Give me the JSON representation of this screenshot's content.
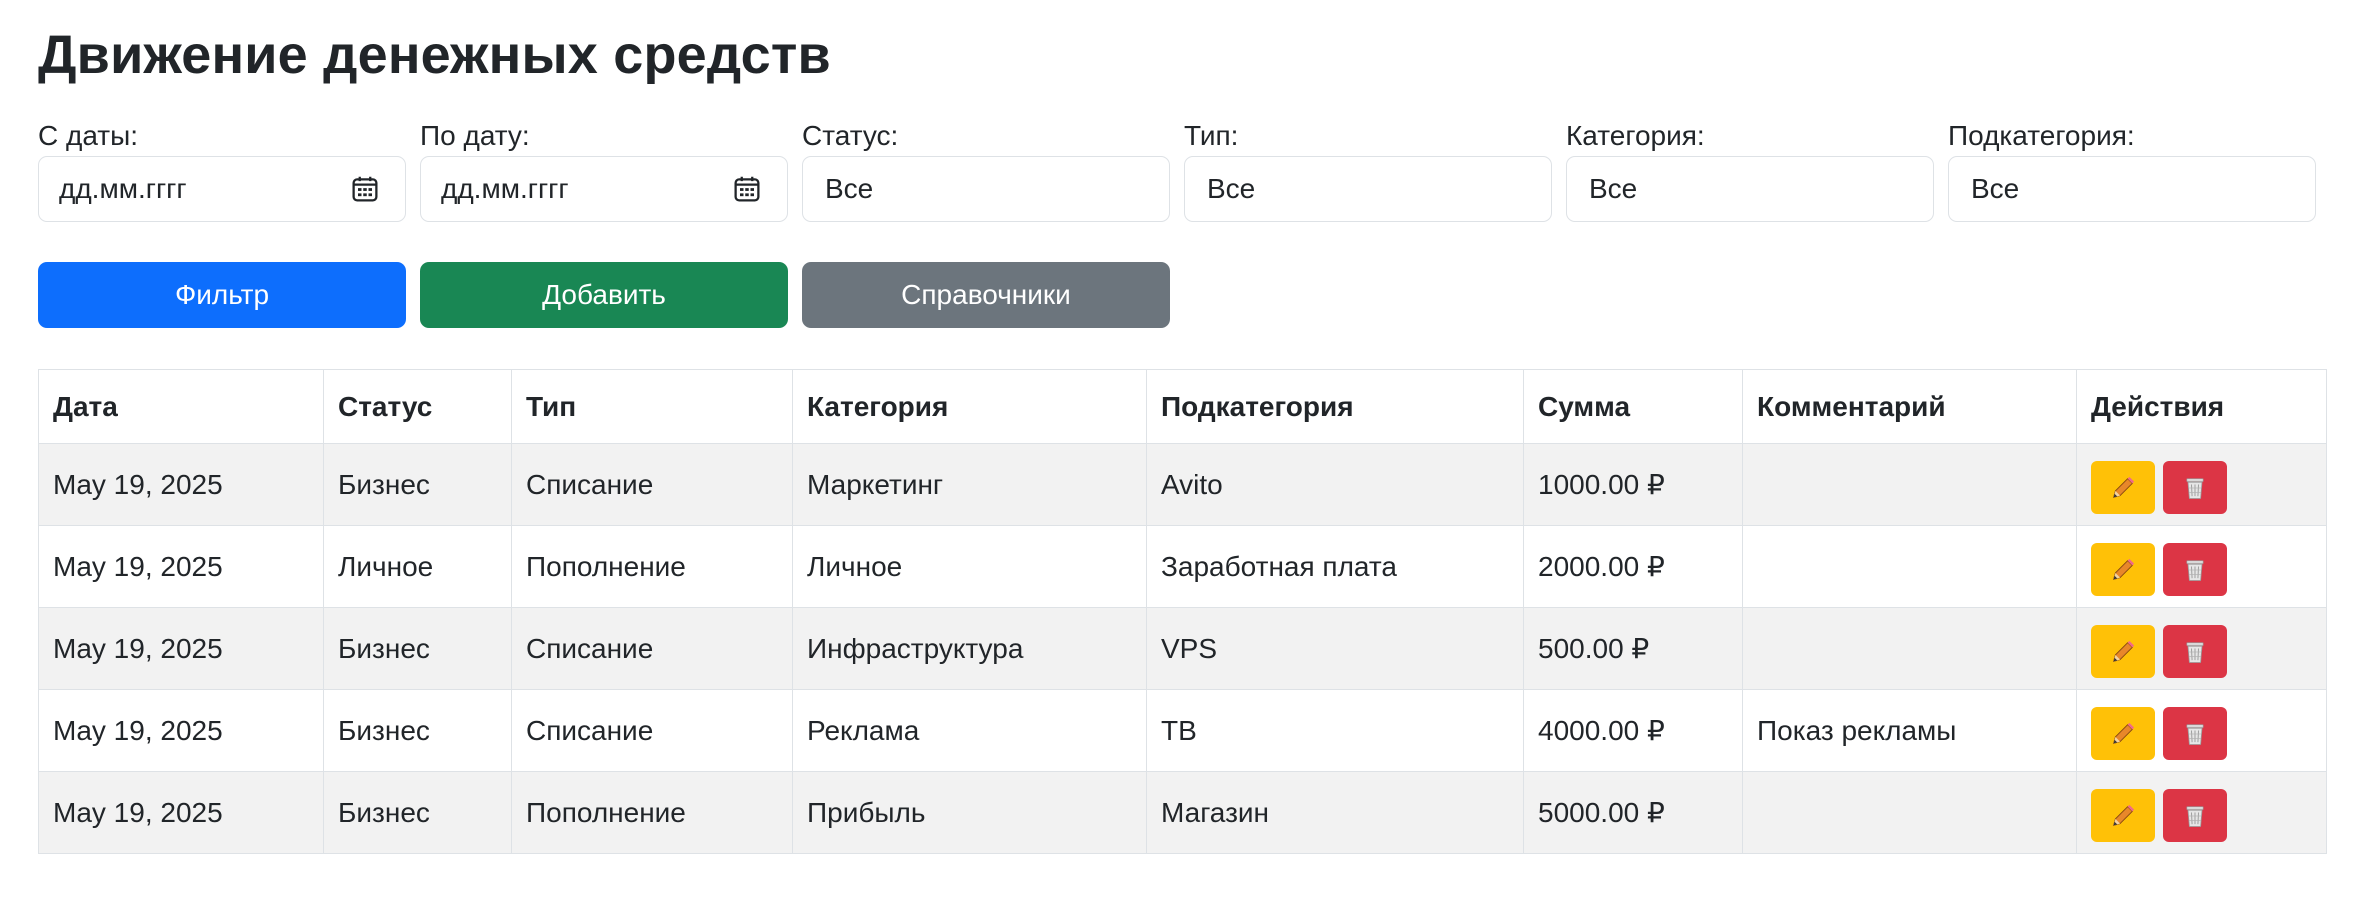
{
  "page": {
    "title": "Движение денежных средств"
  },
  "filters": {
    "date_from": {
      "label": "С даты:",
      "placeholder": "дд.мм.гггг"
    },
    "date_to": {
      "label": "По дату:",
      "placeholder": "дд.мм.гггг"
    },
    "status": {
      "label": "Статус:",
      "value": "Все"
    },
    "type": {
      "label": "Тип:",
      "value": "Все"
    },
    "category": {
      "label": "Категория:",
      "value": "Все"
    },
    "subcategory": {
      "label": "Подкатегория:",
      "value": "Все"
    }
  },
  "buttons": {
    "filter": "Фильтр",
    "add": "Добавить",
    "references": "Справочники"
  },
  "colors": {
    "primary": "#0d6efd",
    "success": "#198754",
    "secondary": "#6c757d",
    "warning": "#ffc107",
    "danger": "#dc3545"
  },
  "icons": {
    "calendar": "calendar-icon",
    "edit": "pencil-icon",
    "delete": "trash-icon"
  },
  "table": {
    "headers": [
      "Дата",
      "Статус",
      "Тип",
      "Категория",
      "Подкатегория",
      "Сумма",
      "Комментарий",
      "Действия"
    ],
    "rows": [
      [
        "May 19, 2025",
        "Бизнес",
        "Списание",
        "Маркетинг",
        "Avito",
        "1000.00 ₽",
        ""
      ],
      [
        "May 19, 2025",
        "Личное",
        "Пополнение",
        "Личное",
        "Заработная плата",
        "2000.00 ₽",
        ""
      ],
      [
        "May 19, 2025",
        "Бизнес",
        "Списание",
        "Инфраструктура",
        "VPS",
        "500.00 ₽",
        ""
      ],
      [
        "May 19, 2025",
        "Бизнес",
        "Списание",
        "Реклама",
        "ТВ",
        "4000.00 ₽",
        "Показ рекламы"
      ],
      [
        "May 19, 2025",
        "Бизнес",
        "Пополнение",
        "Прибыль",
        "Магазин",
        "5000.00 ₽",
        ""
      ]
    ]
  }
}
